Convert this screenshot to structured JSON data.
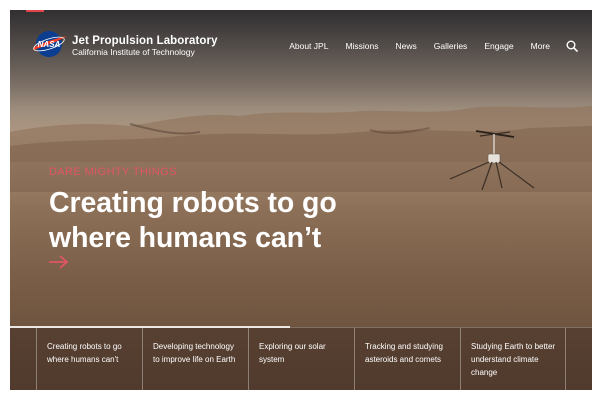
{
  "header": {
    "brand_name": "Jet Propulsion Laboratory",
    "brand_sub": "California Institute of Technology",
    "logo_text": "NASA",
    "nav": [
      "About JPL",
      "Missions",
      "News",
      "Galleries",
      "Engage",
      "More"
    ],
    "search_icon": "search-icon"
  },
  "hero": {
    "eyebrow": "DARE MIGHTY THINGS",
    "headline": "Creating robots to go where humans can’t",
    "arrow_icon": "arrow-right-icon",
    "accent": "#e25563"
  },
  "slides": [
    "Creating robots to go where humans can't",
    "Developing technology to improve life on Earth",
    "Exploring our solar system",
    "Tracking and studying asteroids and comets",
    "Studying Earth to better understand climate change"
  ],
  "colors": {
    "nasa_blue": "#0b3d91",
    "nasa_red": "#fc3d21"
  }
}
